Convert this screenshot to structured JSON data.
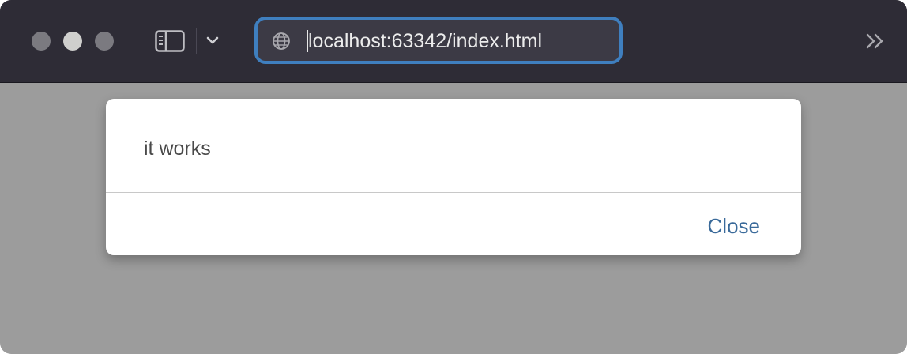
{
  "browser": {
    "address_bar": {
      "url": "localhost:63342/index.html",
      "icon": "globe-icon"
    },
    "toolbar_icons": [
      "sidebar-icon",
      "chevron-down-icon",
      "double-chevron-right-icon"
    ],
    "accent_color": "#3f7fbf"
  },
  "dialog": {
    "message": "it works",
    "close_label": "Close",
    "button_color": "#3a6a9a"
  }
}
